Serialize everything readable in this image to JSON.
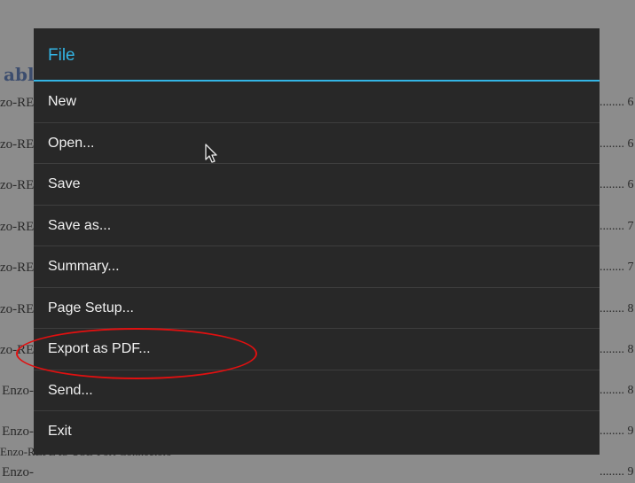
{
  "document": {
    "heading": "able",
    "rows": [
      {
        "left": "zo-RE",
        "right": "........ 6"
      },
      {
        "left": "zo-RE",
        "right": "........ 6"
      },
      {
        "left": "zo-RE",
        "right": "........ 6"
      },
      {
        "left": "zo-RE",
        "right": "........ 7"
      },
      {
        "left": "zo-RE",
        "right": "........ 7"
      },
      {
        "left": "zo-RE",
        "right": "........ 8"
      },
      {
        "left": "zo-RE",
        "right": "........ 8"
      },
      {
        "left": "Enzo-",
        "right": "........ 8"
      },
      {
        "left": "Enzo-",
        "right": "........ 9"
      },
      {
        "left": "Enzo-",
        "right": "........ 9"
      }
    ],
    "bottom_text": "Enzo-REFL IS USB Port Connectors"
  },
  "menu": {
    "title": "File",
    "items": [
      {
        "label": "New",
        "name": "menu-item-new"
      },
      {
        "label": "Open...",
        "name": "menu-item-open"
      },
      {
        "label": "Save",
        "name": "menu-item-save"
      },
      {
        "label": "Save as...",
        "name": "menu-item-save-as"
      },
      {
        "label": "Summary...",
        "name": "menu-item-summary"
      },
      {
        "label": "Page Setup...",
        "name": "menu-item-page-setup"
      },
      {
        "label": "Export as PDF...",
        "name": "menu-item-export-pdf"
      },
      {
        "label": "Send...",
        "name": "menu-item-send"
      },
      {
        "label": "Exit",
        "name": "menu-item-exit"
      }
    ]
  },
  "colors": {
    "accent": "#33b5e5",
    "highlight": "#e01010",
    "menu_background": "#282828"
  },
  "icons": {
    "cursor": "mouse-pointer-icon"
  }
}
